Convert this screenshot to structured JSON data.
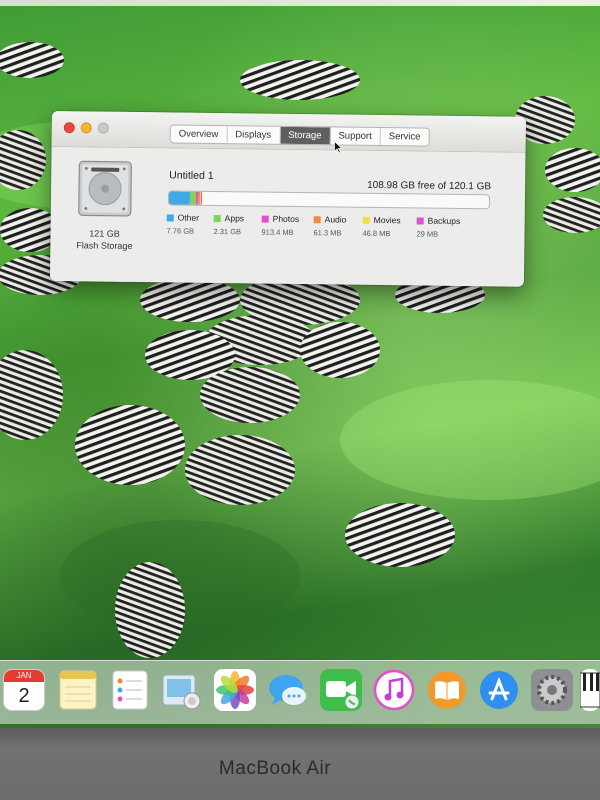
{
  "window": {
    "tabs": [
      "Overview",
      "Displays",
      "Storage",
      "Support",
      "Service"
    ],
    "active_tab": "Storage",
    "drive": {
      "size": "121 GB",
      "type": "Flash Storage"
    },
    "volume": {
      "name": "Untitled 1",
      "free_text": "108.98 GB free of 120.1 GB"
    },
    "usage": [
      {
        "name": "Other",
        "value": "7.76 GB",
        "color": "#3fa9e8",
        "fraction": 0.065
      },
      {
        "name": "Apps",
        "value": "2.31 GB",
        "color": "#7fd35a",
        "fraction": 0.019
      },
      {
        "name": "Photos",
        "value": "913.4 MB",
        "color": "#e24fc8",
        "fraction": 0.008
      },
      {
        "name": "Audio",
        "value": "61.3 MB",
        "color": "#f08a4b",
        "fraction": 0.004
      },
      {
        "name": "Movies",
        "value": "46.8 MB",
        "color": "#f3dc4a",
        "fraction": 0.004
      },
      {
        "name": "Backups",
        "value": "29 MB",
        "color": "#d757d3",
        "fraction": 0.003
      }
    ]
  },
  "dock": {
    "calendar": {
      "month": "JAN",
      "day": "2"
    },
    "apps": [
      "calendar",
      "notes",
      "reminders",
      "contacts",
      "photos",
      "messages",
      "facetime",
      "itunes",
      "ibooks",
      "app-store",
      "system-preferences",
      "piano"
    ]
  },
  "laptop": {
    "brand": "MacBook Air"
  }
}
